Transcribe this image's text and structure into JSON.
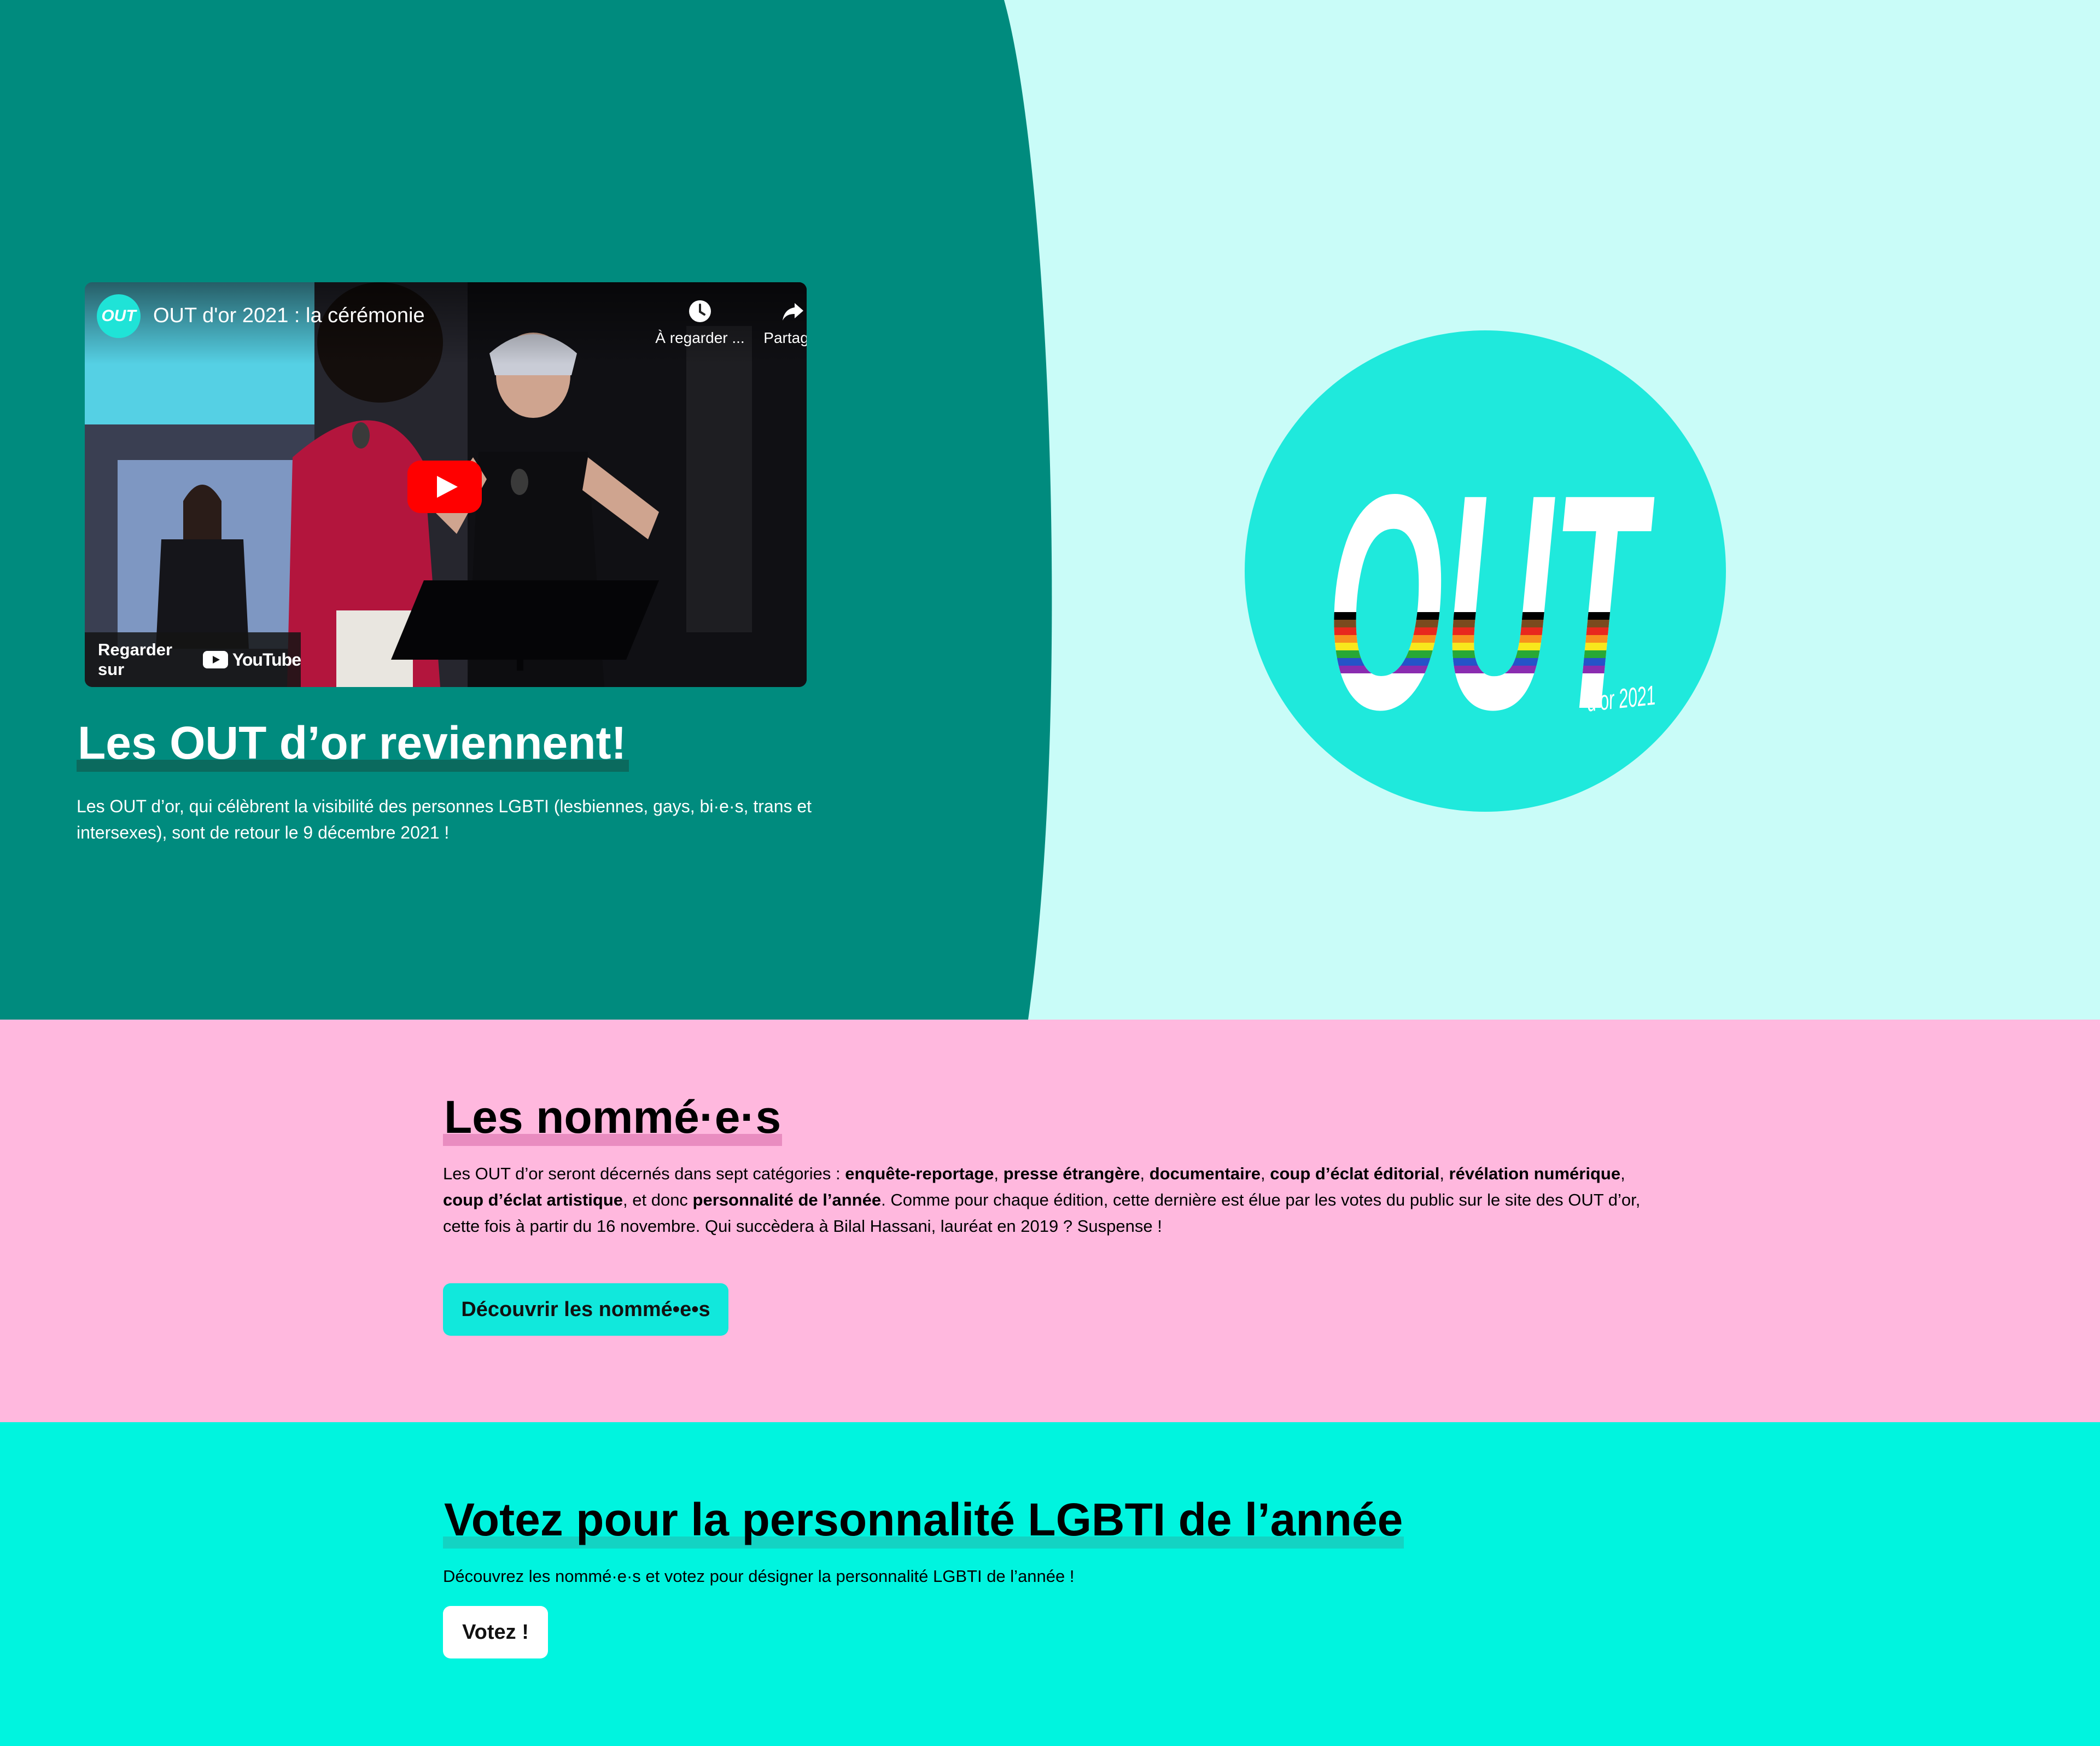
{
  "hero": {
    "video": {
      "channel_avatar_text": "OUT",
      "title": "OUT d'or 2021 : la cérémonie",
      "watch_later_label": "À regarder ...",
      "share_label": "Partager",
      "watch_on_label": "Regarder sur",
      "youtube_wordmark": "YouTube"
    },
    "title": "Les OUT d’or reviennent!",
    "text": "Les OUT d’or, qui célèbrent la visibilité des personnes LGBTI (lesbiennes, gays, bi·e·s, trans et intersexes), sont de retour le 9 décembre 2021 !",
    "logo": {
      "main": "OUT",
      "sub": "d’or 2021"
    }
  },
  "nominees": {
    "title": "Les nommé·e·s",
    "text": {
      "p1": "Les OUT d’or seront décernés dans sept catégories : ",
      "c1": "enquête-reportage",
      "s1": ", ",
      "c2": "presse étrangère",
      "s2": ", ",
      "c3": "documentaire",
      "s3": ", ",
      "c4": "coup d’éclat éditorial",
      "s4": ", ",
      "c5": "révélation numérique",
      "s5": ", ",
      "c6": "coup d’éclat artistique",
      "s6": ", et donc ",
      "c7": "personnalité de l’année",
      "p2": ". Comme pour chaque édition, cette dernière est élue par les votes du public sur le site des OUT d’or, cette fois à partir du 16 novembre. Qui succèdera à Bilal Hassani, lauréat en 2019 ? Suspense !"
    },
    "button_label": "Découvrir les nommé•e•s"
  },
  "vote": {
    "title": "Votez pour la personnalité LGBTI de l’année",
    "text": "Découvrez les nommé·e·s et votez pour désigner la personnalité LGBTI de l’année !",
    "button_label": "Votez !"
  },
  "colors": {
    "hero_left": "#008b7e",
    "hero_right": "#c9fcf8",
    "logo_circle": "#1fe9dc",
    "nominees_bg": "#ffb8de",
    "vote_bg": "#00f4df",
    "button_accent": "#11e8dc"
  }
}
